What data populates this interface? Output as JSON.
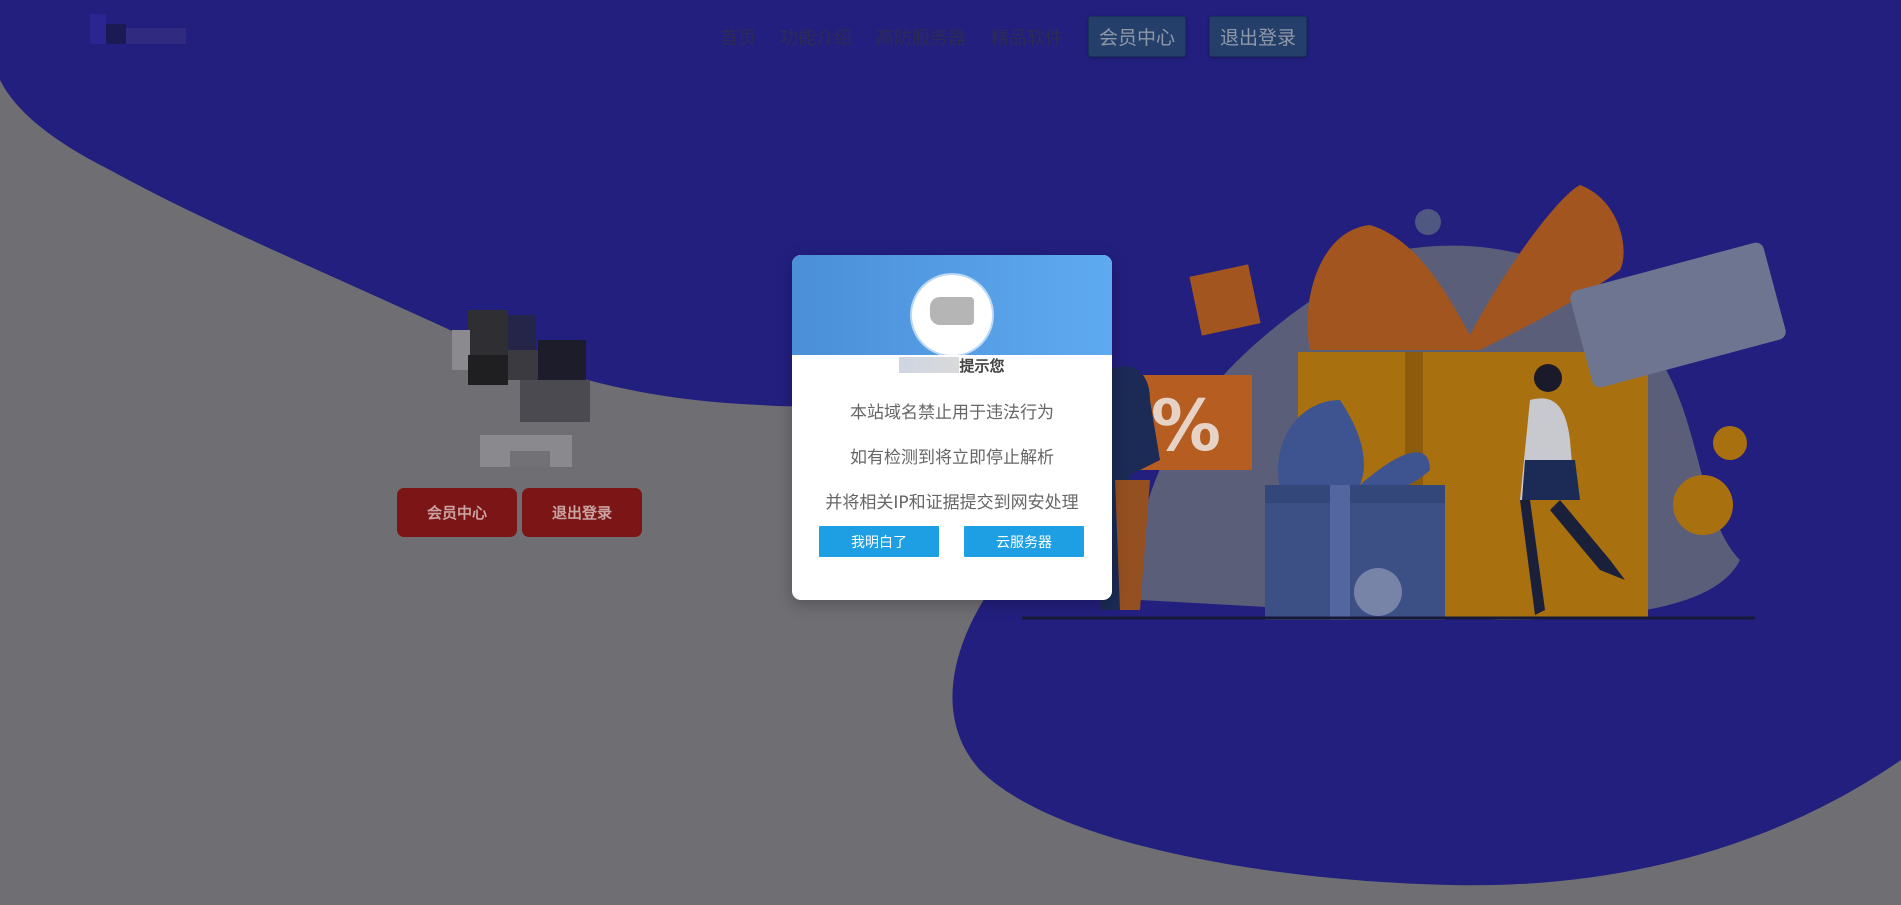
{
  "colors": {
    "overlay_blue": "#231f7f",
    "overlay_gray": "#6f6f73",
    "dialog_button": "#1e9fe3",
    "hero_button": "#7c1616"
  },
  "nav": {
    "links": [
      "首页",
      "功能介绍",
      "高防服务器",
      "精品软件"
    ],
    "member_center": "会员中心",
    "logout": "退出登录"
  },
  "hero": {
    "member_center": "会员中心",
    "logout": "退出登录"
  },
  "dialog": {
    "title": "提示您",
    "lines": [
      "本站域名禁止用于违法行为",
      "如有检测到将立即停止解析",
      "并将相关IP和证据提交到网安处理"
    ],
    "confirm": "我明白了",
    "cloud_server": "云服务器"
  }
}
